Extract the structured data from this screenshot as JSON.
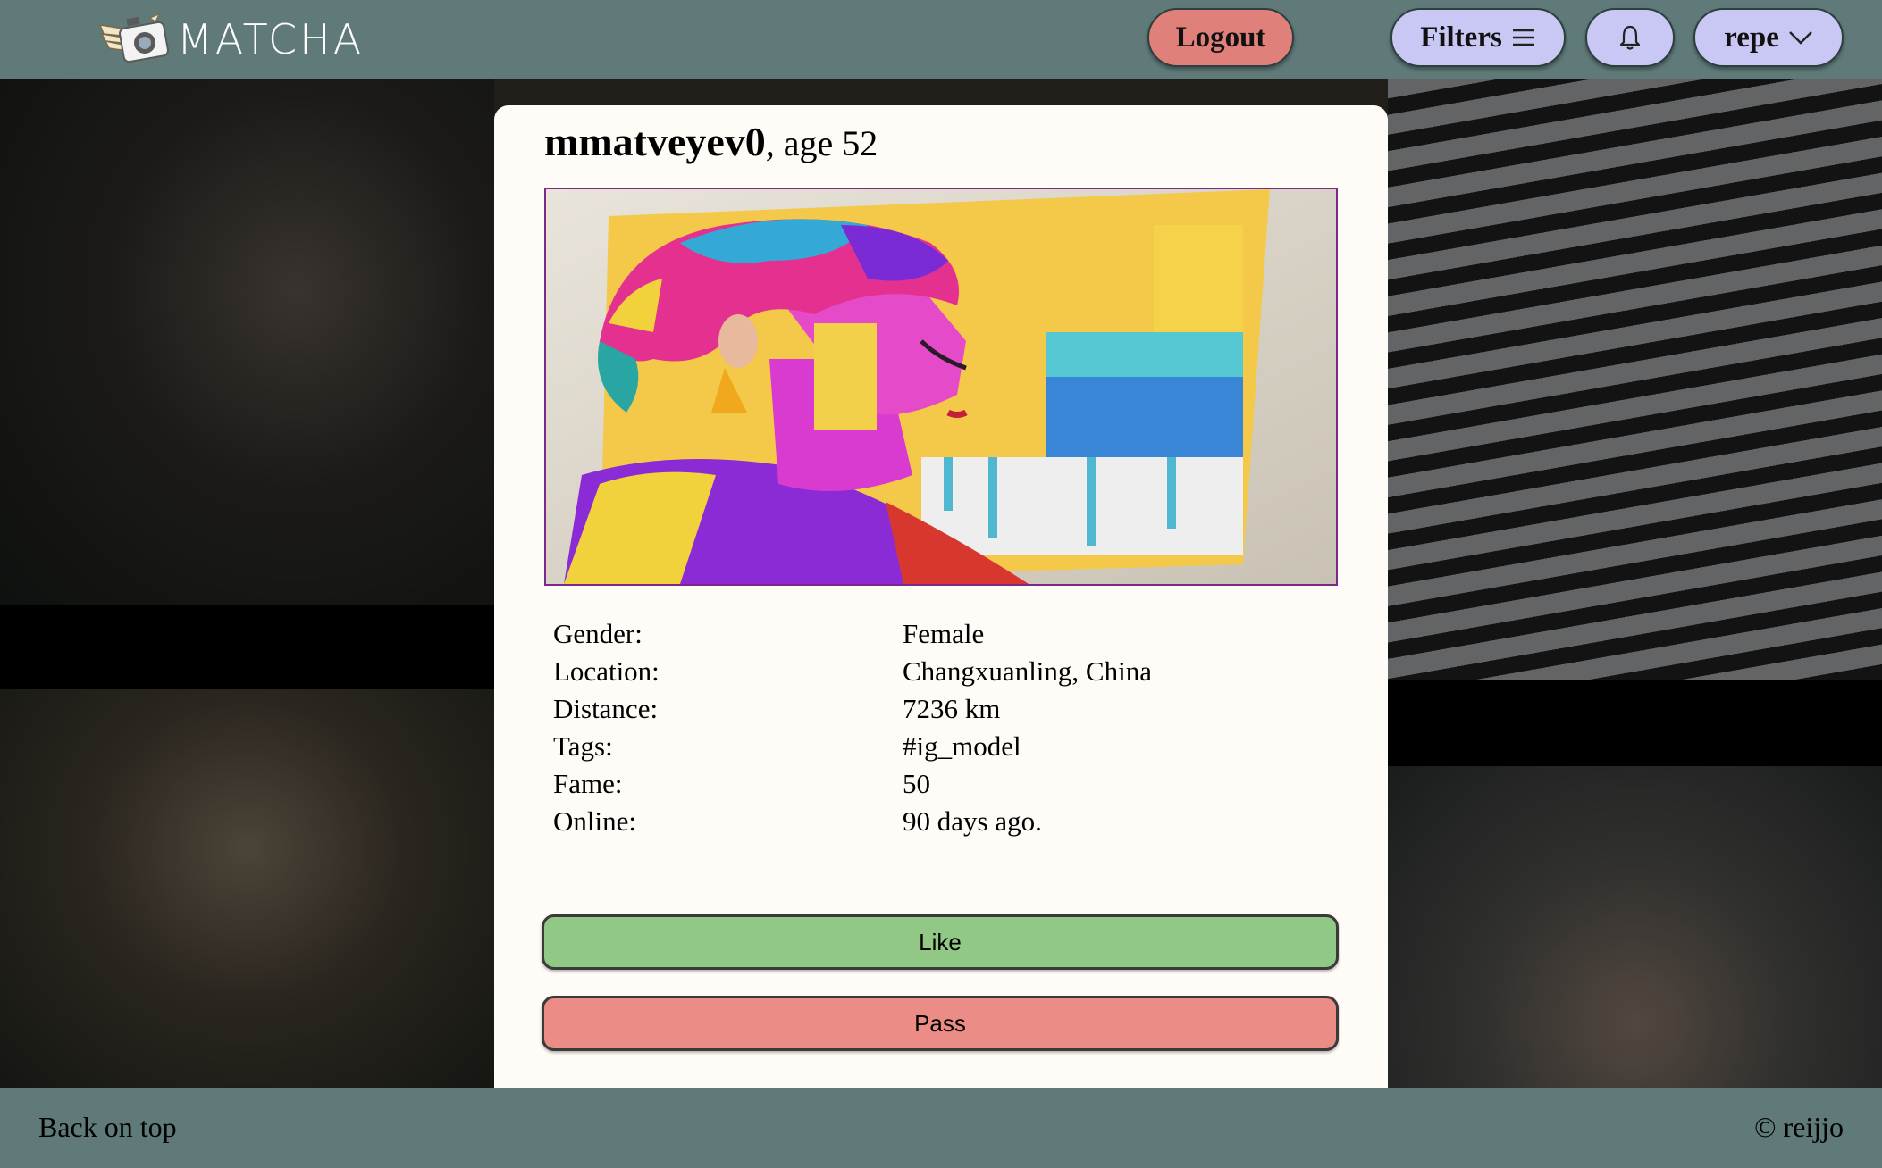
{
  "header": {
    "logo_text": "MATCHA",
    "logout_label": "Logout",
    "filters_label": "Filters",
    "user_label": "repe"
  },
  "profile": {
    "username": "mmatveyev0",
    "age_text": ", age 52",
    "rows": [
      {
        "key": "Gender:",
        "value": "Female"
      },
      {
        "key": "Location:",
        "value": "Changxuanling, China"
      },
      {
        "key": "Distance:",
        "value": "7236 km"
      },
      {
        "key": "Tags:",
        "value": "#ig_model"
      },
      {
        "key": "Fame:",
        "value": "50"
      },
      {
        "key": "Online:",
        "value": "90 days ago."
      }
    ]
  },
  "actions": {
    "like_label": "Like",
    "pass_label": "Pass"
  },
  "footer": {
    "back_label": "Back on top",
    "copyright": "© reijjo"
  },
  "colors": {
    "header_bg": "#5f7a79",
    "logout_bg": "#e0807a",
    "nav_pill_bg": "#c9c8f4",
    "like_bg": "#92c886",
    "pass_bg": "#ec8c87",
    "card_bg": "#fffbf7",
    "photo_border": "#7b2a8a"
  },
  "icons": {
    "logo": "winged-camera-icon",
    "filters": "hamburger-icon",
    "notifications": "bell-icon",
    "user_menu": "chevron-down-icon"
  }
}
